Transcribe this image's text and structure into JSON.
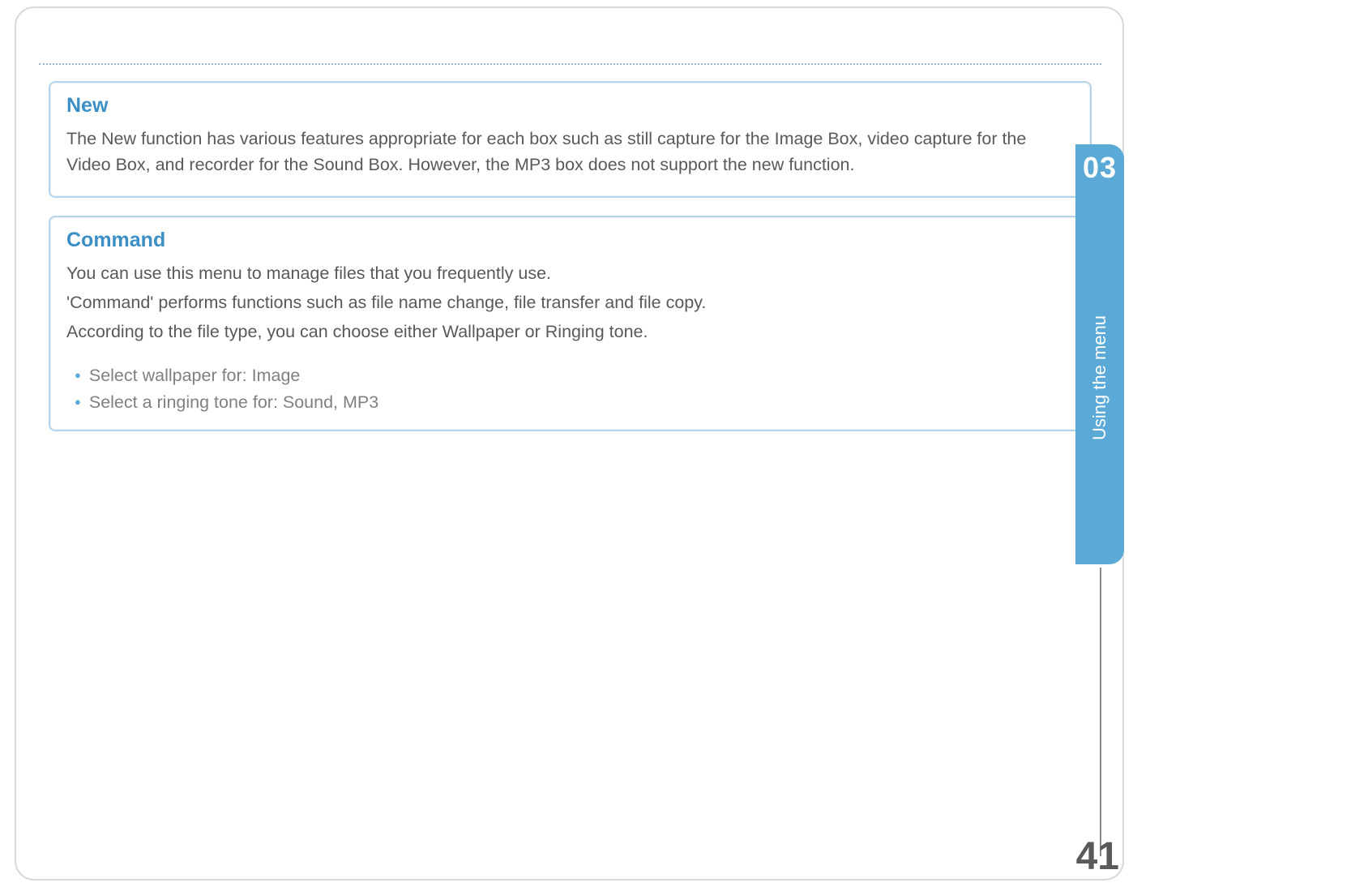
{
  "sections": {
    "new": {
      "title": "New",
      "body": "The New function has various features appropriate for each box such as still capture for the Image Box, video capture for the Video Box, and recorder for the Sound Box. However, the MP3 box does not support the new function."
    },
    "command": {
      "title": "Command",
      "body_line1": "You can use this menu to manage files that you frequently use.",
      "body_line2": "'Command' performs functions such as file name change, file transfer and file copy.",
      "body_line3": "According to the file type, you can choose either Wallpaper or Ringing tone.",
      "bullets": {
        "0": "Select wallpaper for: Image",
        "1": "Select a ringing tone for: Sound, MP3"
      }
    }
  },
  "side": {
    "chapter": "03",
    "label": "Using the menu"
  },
  "page_number": "41"
}
